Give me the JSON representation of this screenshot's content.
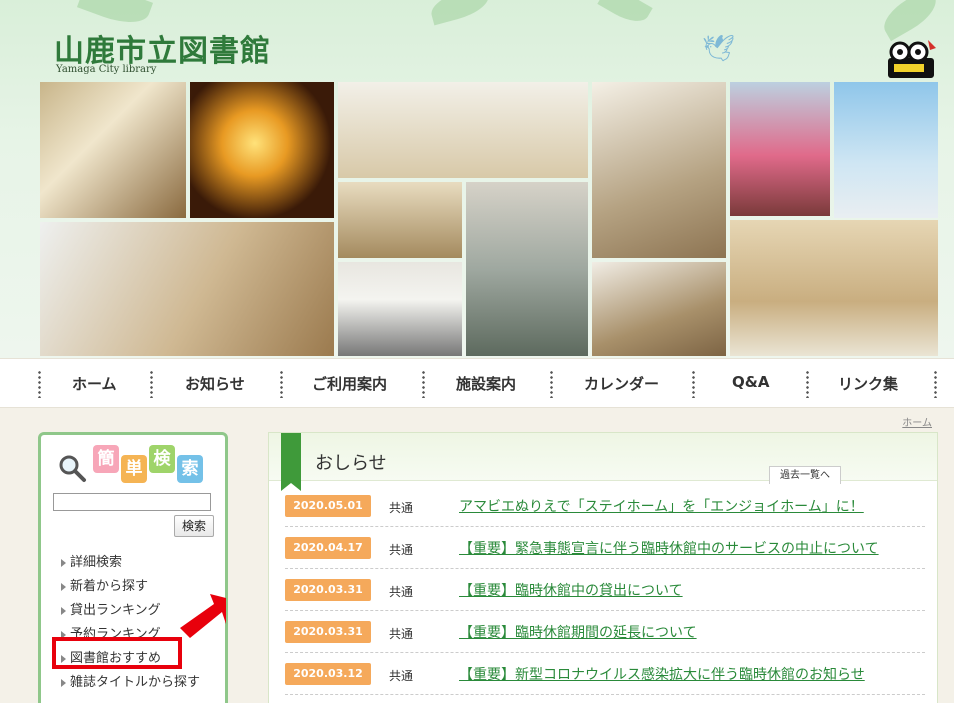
{
  "header": {
    "title": "山鹿市立図書館",
    "subtitle": "Yamaga City library"
  },
  "nav": [
    "ホーム",
    "お知らせ",
    "ご利用案内",
    "施設案内",
    "カレンダー",
    "Q&A",
    "リンク集"
  ],
  "breadcrumb": "ホーム",
  "sidebar": {
    "search_title_chars": [
      "簡",
      "単",
      "検",
      "索"
    ],
    "search_value": "",
    "search_button": "検索",
    "links": [
      "詳細検索",
      "新着から探す",
      "貸出ランキング",
      "予約ランキング",
      "図書館おすすめ",
      "雑誌タイトルから探す"
    ]
  },
  "news": {
    "title": "おしらせ",
    "archive_label": "過去一覧へ",
    "items": [
      {
        "date": "2020.05.01",
        "category": "共通",
        "text": "アマビエぬりえで「ステイホーム」を「エンジョイホーム」に！"
      },
      {
        "date": "2020.04.17",
        "category": "共通",
        "text": "【重要】緊急事態宣言に伴う臨時休館中のサービスの中止について"
      },
      {
        "date": "2020.03.31",
        "category": "共通",
        "text": "【重要】臨時休館中の貸出について"
      },
      {
        "date": "2020.03.31",
        "category": "共通",
        "text": "【重要】臨時休館期間の延長について"
      },
      {
        "date": "2020.03.12",
        "category": "共通",
        "text": "【重要】新型コロナウイルス感染拡大に伴う臨時休館のお知らせ"
      }
    ]
  },
  "colors": {
    "accent_green": "#3f9a3a",
    "date_orange": "#f5a95b",
    "link_green": "#2a8a3a",
    "highlight_red": "#e8000c"
  }
}
